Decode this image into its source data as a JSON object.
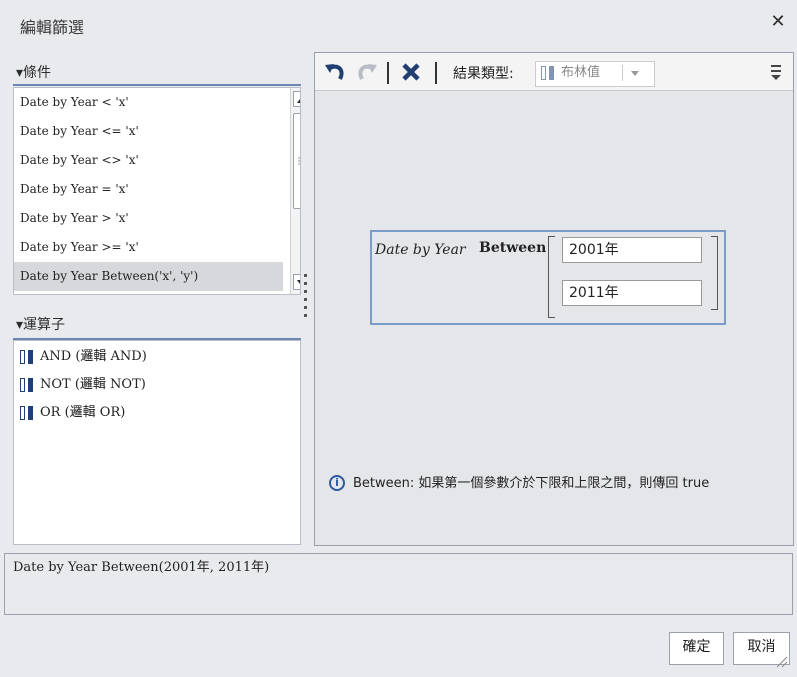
{
  "dialog": {
    "title": "編輯篩選",
    "close_symbol": "✕"
  },
  "conditions": {
    "header": "▾條件",
    "items": [
      "Date by Year < 'x'",
      "Date by Year <= 'x'",
      "Date by Year <> 'x'",
      "Date by Year = 'x'",
      "Date by Year > 'x'",
      "Date by Year >= 'x'",
      "Date by Year Between('x', 'y')"
    ],
    "selected_index": 6
  },
  "operators": {
    "header": "▾運算子",
    "items": [
      "AND (邏輯 AND)",
      "NOT (邏輯 NOT)",
      "OR (邏輯 OR)"
    ]
  },
  "toolbar": {
    "undo_symbol": "↶",
    "redo_symbol": "↷",
    "delete_symbol": "✖",
    "result_type_label": "結果類型:",
    "result_type_value": "布林值",
    "overflow_symbol": "⁝"
  },
  "expression": {
    "field": "Date by Year",
    "operator": "Between",
    "value1": "2001年",
    "value2": "2011年"
  },
  "info": {
    "icon_symbol": "i",
    "text": "Between: 如果第一個參數介於下限和上限之間，則傳回 true"
  },
  "result_text": "Date by Year Between(2001年, 2011年)",
  "buttons": {
    "ok": "確定",
    "cancel": "取消"
  },
  "colors": {
    "background": "#e9eaed",
    "accent_line": "#6d87b3",
    "expression_border": "#7a9bc6",
    "selected_row": "#d7d8db",
    "icon_blue": "#1f3f72"
  }
}
